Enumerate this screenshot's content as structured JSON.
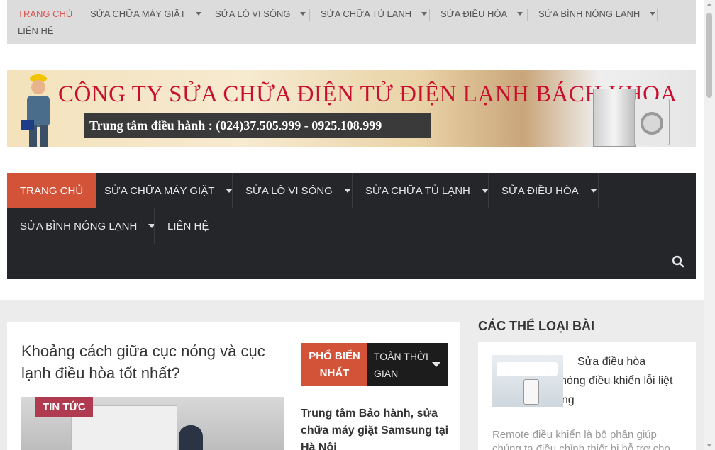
{
  "top_nav": {
    "items": [
      {
        "label": "TRANG CHỦ",
        "active": true,
        "has_dropdown": false
      },
      {
        "label": "SỬA CHỮA MÁY GIẶT",
        "has_dropdown": true
      },
      {
        "label": "SỬA LÒ VI SÓNG",
        "has_dropdown": true
      },
      {
        "label": "SỬA CHỮA TỦ LẠNH",
        "has_dropdown": true
      },
      {
        "label": "SỬA ĐIỀU HÒA",
        "has_dropdown": true
      },
      {
        "label": "SỬA BÌNH NÓNG LẠNH",
        "has_dropdown": true
      },
      {
        "label": "LIÊN HỆ",
        "has_dropdown": false
      }
    ]
  },
  "banner": {
    "title": "CÔNG TY SỬA CHỮA ĐIỆN TỬ ĐIỆN LẠNH BÁCH KHOA",
    "hotline": "Trung tâm điều hành : (024)37.505.999 - 0925.108.999"
  },
  "main_nav": {
    "items": [
      {
        "label": "TRANG CHỦ",
        "active": true,
        "has_dropdown": false
      },
      {
        "label": "SỬA CHỮA MÁY GIẶT",
        "has_dropdown": true
      },
      {
        "label": "SỬA LÒ VI SÓNG",
        "has_dropdown": true
      },
      {
        "label": "SỬA CHỮA TỦ LẠNH",
        "has_dropdown": true
      },
      {
        "label": "SỬA ĐIỀU HÒA",
        "has_dropdown": true
      },
      {
        "label": "SỬA BÌNH NÓNG LẠNH",
        "has_dropdown": true
      },
      {
        "label": "LIÊN HỆ",
        "has_dropdown": false
      }
    ],
    "search_icon": "search-icon"
  },
  "article": {
    "headline": "Khoảng cách giữa cục nóng và cục lạnh điều hòa tốt nhất?",
    "category_badge": "TIN TỨC"
  },
  "popular_widget": {
    "tab_popular": "PHỔ BIẾN NHẤT",
    "tab_time": "TOÀN THỜI GIAN",
    "post_title": "Trung tâm Bảo hành, sửa chữa máy giặt Samsung tại Hà Nội"
  },
  "sidebar": {
    "heading": "CÁC THỂ LOẠI BÀI",
    "post": {
      "title": "Sửa điều hòa Panasonic bị hỏng điều khiển lỗi liệt phím chức năng",
      "excerpt": "Remote điều khiển là bộ phận giúp chúng ta điều chỉnh thiết bị hỗ trợ cho"
    }
  },
  "colors": {
    "accent": "#d35339",
    "nav_dark": "#25262a",
    "top_nav_bg": "#dcdcdc",
    "badge": "#b03a4f",
    "banner_title": "#c8102e"
  }
}
